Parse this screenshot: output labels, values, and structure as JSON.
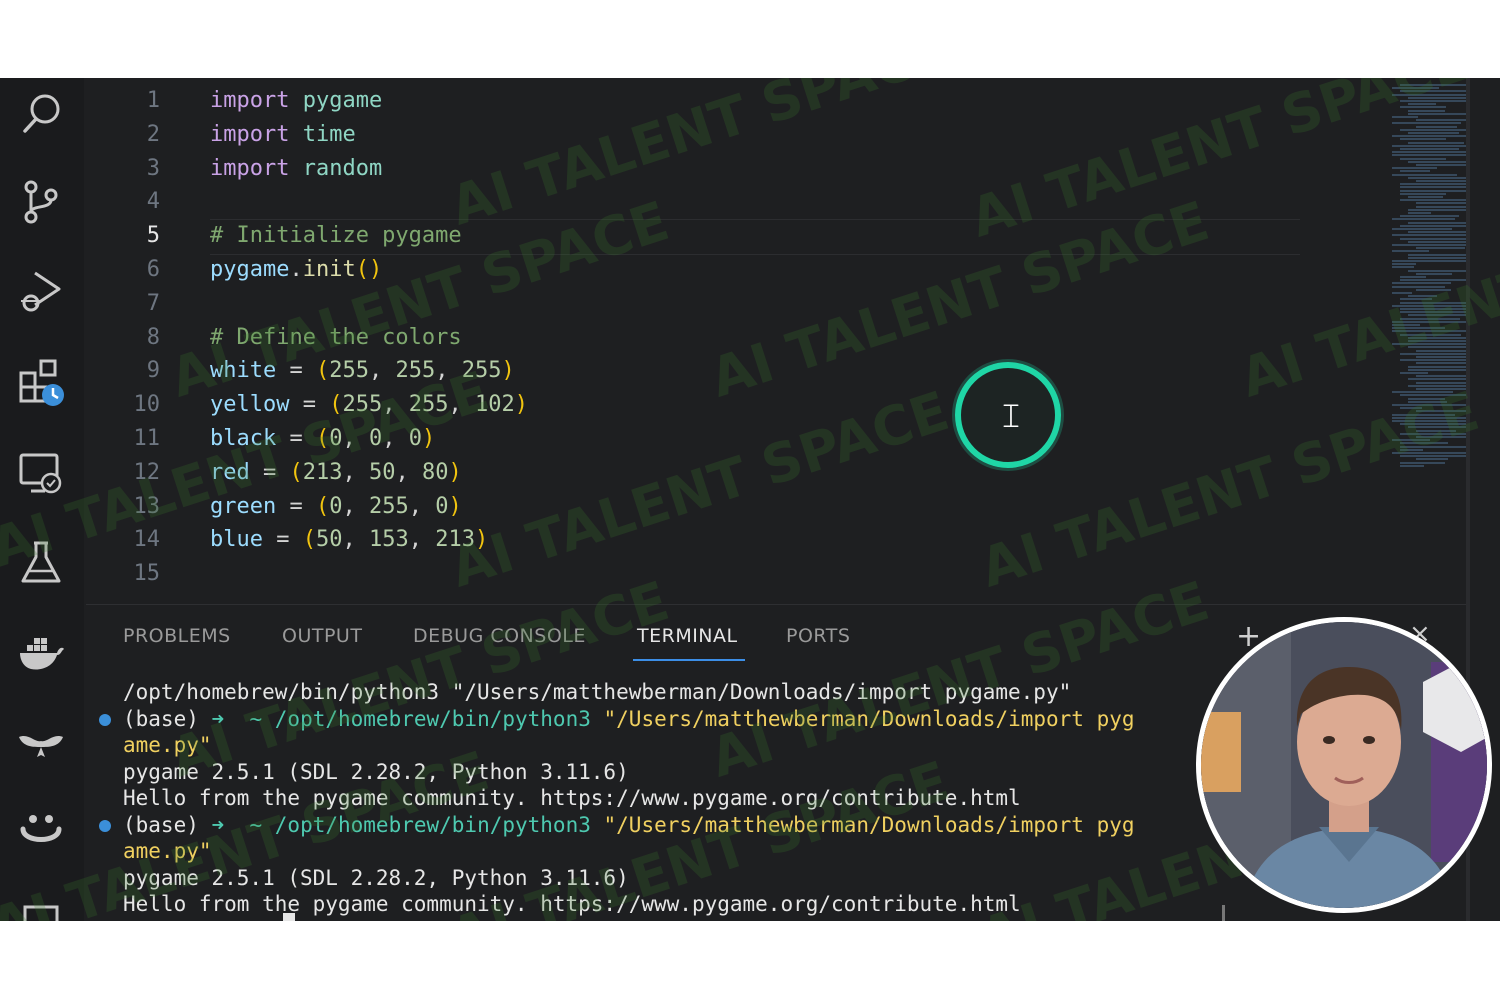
{
  "activity_bar": {
    "icons": [
      "search-icon",
      "source-control-icon",
      "run-debug-icon",
      "extensions-icon",
      "remote-explorer-icon",
      "testing-icon",
      "docker-icon",
      "copilot-icon",
      "ai-assistant-icon",
      "more-icon"
    ]
  },
  "editor": {
    "current_line": 5,
    "lines": [
      {
        "n": "1",
        "tokens": [
          {
            "t": "import",
            "c": "kw"
          },
          {
            "t": " ",
            "c": "pl"
          },
          {
            "t": "pygame",
            "c": "mod"
          }
        ]
      },
      {
        "n": "2",
        "tokens": [
          {
            "t": "import",
            "c": "kw"
          },
          {
            "t": " ",
            "c": "pl"
          },
          {
            "t": "time",
            "c": "mod"
          }
        ]
      },
      {
        "n": "3",
        "tokens": [
          {
            "t": "import",
            "c": "kw"
          },
          {
            "t": " ",
            "c": "pl"
          },
          {
            "t": "random",
            "c": "mod"
          }
        ]
      },
      {
        "n": "4",
        "tokens": []
      },
      {
        "n": "5",
        "tokens": [
          {
            "t": "# Initialize pygame",
            "c": "cm"
          }
        ]
      },
      {
        "n": "6",
        "tokens": [
          {
            "t": "pygame",
            "c": "vr"
          },
          {
            "t": ".",
            "c": "pl"
          },
          {
            "t": "init",
            "c": "fn"
          },
          {
            "t": "()",
            "c": "br"
          }
        ]
      },
      {
        "n": "7",
        "tokens": []
      },
      {
        "n": "8",
        "tokens": [
          {
            "t": "# Define the colors",
            "c": "cm"
          }
        ]
      },
      {
        "n": "9",
        "tokens": [
          {
            "t": "white",
            "c": "vr"
          },
          {
            "t": " = ",
            "c": "pl"
          },
          {
            "t": "(",
            "c": "br"
          },
          {
            "t": "255",
            "c": "nm"
          },
          {
            "t": ", ",
            "c": "pl"
          },
          {
            "t": "255",
            "c": "nm"
          },
          {
            "t": ", ",
            "c": "pl"
          },
          {
            "t": "255",
            "c": "nm"
          },
          {
            "t": ")",
            "c": "br"
          }
        ]
      },
      {
        "n": "10",
        "tokens": [
          {
            "t": "yellow",
            "c": "vr"
          },
          {
            "t": " = ",
            "c": "pl"
          },
          {
            "t": "(",
            "c": "br"
          },
          {
            "t": "255",
            "c": "nm"
          },
          {
            "t": ", ",
            "c": "pl"
          },
          {
            "t": "255",
            "c": "nm"
          },
          {
            "t": ", ",
            "c": "pl"
          },
          {
            "t": "102",
            "c": "nm"
          },
          {
            "t": ")",
            "c": "br"
          }
        ]
      },
      {
        "n": "11",
        "tokens": [
          {
            "t": "black",
            "c": "vr"
          },
          {
            "t": " = ",
            "c": "pl"
          },
          {
            "t": "(",
            "c": "br"
          },
          {
            "t": "0",
            "c": "nm"
          },
          {
            "t": ", ",
            "c": "pl"
          },
          {
            "t": "0",
            "c": "nm"
          },
          {
            "t": ", ",
            "c": "pl"
          },
          {
            "t": "0",
            "c": "nm"
          },
          {
            "t": ")",
            "c": "br"
          }
        ]
      },
      {
        "n": "12",
        "tokens": [
          {
            "t": "red",
            "c": "vr"
          },
          {
            "t": " = ",
            "c": "pl"
          },
          {
            "t": "(",
            "c": "br"
          },
          {
            "t": "213",
            "c": "nm"
          },
          {
            "t": ", ",
            "c": "pl"
          },
          {
            "t": "50",
            "c": "nm"
          },
          {
            "t": ", ",
            "c": "pl"
          },
          {
            "t": "80",
            "c": "nm"
          },
          {
            "t": ")",
            "c": "br"
          }
        ]
      },
      {
        "n": "13",
        "tokens": [
          {
            "t": "green",
            "c": "vr"
          },
          {
            "t": " = ",
            "c": "pl"
          },
          {
            "t": "(",
            "c": "br"
          },
          {
            "t": "0",
            "c": "nm"
          },
          {
            "t": ", ",
            "c": "pl"
          },
          {
            "t": "255",
            "c": "nm"
          },
          {
            "t": ", ",
            "c": "pl"
          },
          {
            "t": "0",
            "c": "nm"
          },
          {
            "t": ")",
            "c": "br"
          }
        ]
      },
      {
        "n": "14",
        "tokens": [
          {
            "t": "blue",
            "c": "vr"
          },
          {
            "t": " = ",
            "c": "pl"
          },
          {
            "t": "(",
            "c": "br"
          },
          {
            "t": "50",
            "c": "nm"
          },
          {
            "t": ", ",
            "c": "pl"
          },
          {
            "t": "153",
            "c": "nm"
          },
          {
            "t": ", ",
            "c": "pl"
          },
          {
            "t": "213",
            "c": "nm"
          },
          {
            "t": ")",
            "c": "br"
          }
        ]
      },
      {
        "n": "15",
        "tokens": []
      }
    ]
  },
  "panel": {
    "tabs": [
      {
        "label": "PROBLEMS",
        "active": false
      },
      {
        "label": "OUTPUT",
        "active": false
      },
      {
        "label": "DEBUG CONSOLE",
        "active": false
      },
      {
        "label": "TERMINAL",
        "active": true
      },
      {
        "label": "PORTS",
        "active": false
      }
    ],
    "new_terminal_glyph": "+",
    "close_glyph": "×",
    "terminal": {
      "line1": "/opt/homebrew/bin/python3 \"/Users/matthewberman/Downloads/import pygame.py\"",
      "prompt_base": "(base)",
      "prompt_arrow": "➜",
      "prompt_dir": "~",
      "command": "/opt/homebrew/bin/python3",
      "arg_part1": "\"/Users/matthewberman/Downloads/import pyg",
      "arg_part2": "ame.py\"",
      "pygame_version": "pygame 2.5.1 (SDL 2.28.2, Python 3.11.6)",
      "hello": "Hello from the pygame community. https://www.pygame.org/contribute.html"
    }
  },
  "watermark": {
    "text": "AI TALENT SPACE",
    "color": "#3a7a2c"
  },
  "colors": {
    "accent": "#3c8ee6",
    "cursor_ring": "#1fd6a6",
    "background": "#1e1f21"
  }
}
